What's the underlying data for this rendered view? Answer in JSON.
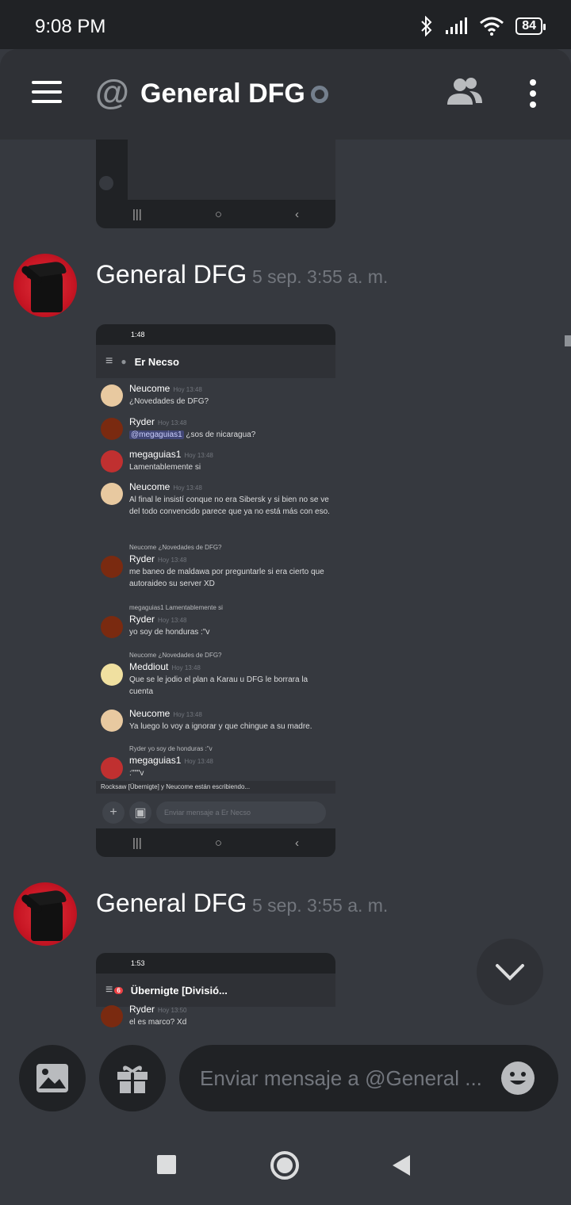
{
  "status_bar": {
    "time": "9:08 PM",
    "battery": "84"
  },
  "header": {
    "at_symbol": "@",
    "title": "General DFG"
  },
  "messages": [
    {
      "author": "General DFG",
      "timestamp": "5 sep. 3:55 a. m."
    },
    {
      "author": "General DFG",
      "timestamp": "5 sep. 3:55 a. m."
    }
  ],
  "screenshot1": {
    "status_time": "1:48",
    "channel": "Er Necso",
    "messages": [
      {
        "name": "Neucome",
        "time": "Hoy 13:48",
        "text": "¿Novedades de DFG?"
      },
      {
        "name": "Ryder",
        "time": "Hoy 13:48",
        "mention": "@megaguias1",
        "text": " ¿sos de nicaragua?"
      },
      {
        "name": "megaguias1",
        "time": "Hoy 13:48",
        "text": "Lamentablemente si"
      },
      {
        "name": "Neucome",
        "time": "Hoy 13:48",
        "text": "Al final le insistí conque no era Sibersk y si bien no se ve del todo convencido parece que ya no está más con eso."
      },
      {
        "reply": "Neucome ¿Novedades de DFG?",
        "name": "Ryder",
        "time": "Hoy 13:48",
        "text": "me baneo de maldawa por preguntarle si era cierto que autoraideo su server XD"
      },
      {
        "reply": "megaguias1 Lamentablemente si",
        "name": "Ryder",
        "time": "Hoy 13:48",
        "text": "yo soy de honduras :\"v"
      },
      {
        "reply": "Neucome ¿Novedades de DFG?",
        "name": "Meddiout",
        "time": "Hoy 13:48",
        "text": "Que se le jodio el plan a Karau u DFG le borrara la cuenta"
      },
      {
        "name": "Neucome",
        "time": "Hoy 13:48",
        "text": "Ya luego lo voy a ignorar y que chingue a su madre."
      },
      {
        "reply": "Ryder yo soy de honduras :\"v",
        "name": "megaguias1",
        "time": "Hoy 13:48",
        "text": ":\"\"\"v"
      }
    ],
    "typing": "Rocksaw [Übernigte] y Neucome están escribiendo...",
    "input_placeholder": "Enviar mensaje a Er Necso"
  },
  "screenshot2": {
    "status_time": "1:53",
    "channel": "Übernigte [Divisió...",
    "badge": "6",
    "partial_name": "Ryder",
    "partial_time": "Hoy 13:50",
    "partial_text": "el es marco? Xd"
  },
  "composer": {
    "placeholder": "Enviar mensaje a @General ..."
  }
}
